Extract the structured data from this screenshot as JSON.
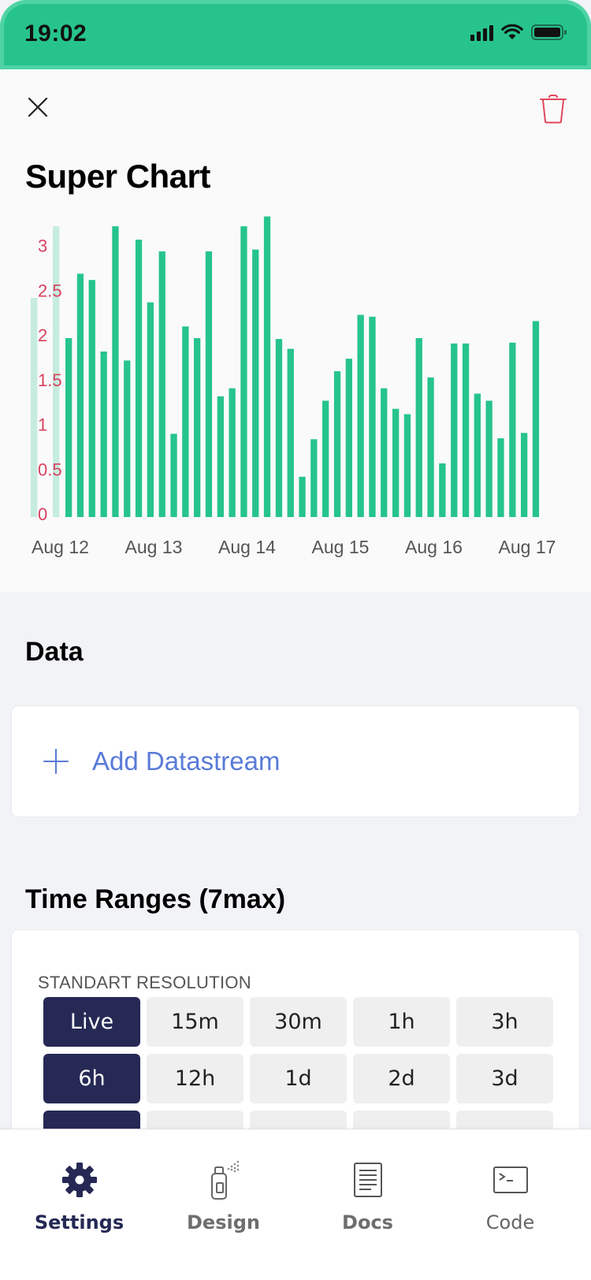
{
  "status_bar": {
    "time": "19:02"
  },
  "header": {
    "close_icon": "close-icon",
    "delete_icon": "trash-icon",
    "delete_color": "#e0475d"
  },
  "chart": {
    "title": "Super Chart"
  },
  "chart_data": {
    "type": "bar",
    "title": "Super Chart",
    "xlabel": "",
    "ylabel": "",
    "ylim": [
      0,
      3.25
    ],
    "y_ticks": [
      "0",
      "0.5",
      "1",
      "1.5",
      "2",
      "2.5",
      "3"
    ],
    "x_ticks": [
      "Aug 12",
      "Aug 13",
      "Aug 14",
      "Aug 15",
      "Aug 16",
      "Aug 17"
    ],
    "bar_color": "#26c48c",
    "tick_label_color": "#d9415e",
    "values": [
      2.45,
      3.25,
      2.0,
      2.72,
      2.65,
      1.85,
      3.25,
      1.75,
      3.1,
      2.4,
      2.97,
      0.93,
      2.13,
      2.0,
      2.97,
      1.35,
      1.44,
      3.25,
      2.99,
      3.36,
      1.99,
      1.88,
      0.45,
      0.87,
      1.3,
      1.63,
      1.77,
      2.26,
      2.24,
      1.44,
      1.21,
      1.15,
      2.0,
      1.56,
      0.6,
      1.94,
      1.94,
      1.38,
      1.3,
      0.88,
      1.95,
      0.94,
      2.19
    ],
    "grid": false,
    "legend": "none"
  },
  "data_section": {
    "title": "Data",
    "add_label": "Add Datastream"
  },
  "time_ranges": {
    "title": "Time Ranges (7max)",
    "resolution_label": "STANDART RESOLUTION",
    "buttons": [
      {
        "label": "Live",
        "active": true
      },
      {
        "label": "15m",
        "active": false
      },
      {
        "label": "30m",
        "active": false
      },
      {
        "label": "1h",
        "active": false
      },
      {
        "label": "3h",
        "active": false
      },
      {
        "label": "6h",
        "active": true
      },
      {
        "label": "12h",
        "active": false
      },
      {
        "label": "1d",
        "active": false
      },
      {
        "label": "2d",
        "active": false
      },
      {
        "label": "3d",
        "active": false
      },
      {
        "label": "",
        "active": true
      },
      {
        "label": "",
        "active": false
      },
      {
        "label": "",
        "active": false
      },
      {
        "label": "",
        "active": false
      },
      {
        "label": "",
        "active": false
      }
    ]
  },
  "tabs": [
    {
      "label": "Settings",
      "icon": "gear-icon",
      "active": true
    },
    {
      "label": "Design",
      "icon": "spray-can-icon",
      "active": false
    },
    {
      "label": "Docs",
      "icon": "document-icon",
      "active": false
    },
    {
      "label": "Code",
      "icon": "terminal-icon",
      "active": false
    }
  ],
  "colors": {
    "accent": "#26c48c",
    "dark": "#252954",
    "link": "#5a7bd8"
  }
}
